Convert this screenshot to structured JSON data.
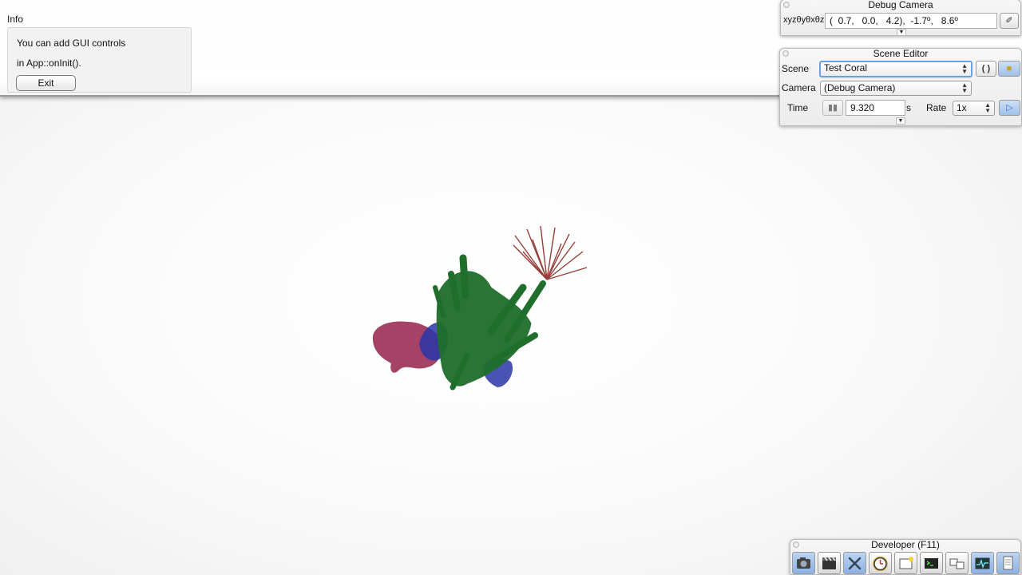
{
  "info": {
    "title": "Info",
    "line1": "You can add GUI controls",
    "line2": "in App::onInit().",
    "exit_label": "Exit"
  },
  "debug_camera": {
    "title": "Debug Camera",
    "label": "xyzθyθxθz",
    "value": "(  0.7,   0.0,   4.2),  -1.7º,   8.6º"
  },
  "scene_editor": {
    "title": "Scene Editor",
    "scene_label": "Scene",
    "scene_value": "Test Coral",
    "camera_label": "Camera",
    "camera_value": "(Debug Camera)",
    "time_label": "Time",
    "time_value": "9.320",
    "time_unit": "s",
    "rate_label": "Rate",
    "rate_value": "1x"
  },
  "developer": {
    "title": "Developer (F11)",
    "tools": [
      "camera-icon",
      "film-clapper-icon",
      "wrench-tools-icon",
      "stopwatch-icon",
      "new-window-icon",
      "terminal-icon",
      "network-windows-icon",
      "profiler-graph-icon",
      "document-icon"
    ]
  },
  "colors": {
    "accent_focus": "#6aa0e4",
    "coral_green": "#1f6e2c",
    "coral_red": "#8a2a24",
    "coral_pink": "#9a2f55",
    "coral_blue": "#2a36a8"
  }
}
